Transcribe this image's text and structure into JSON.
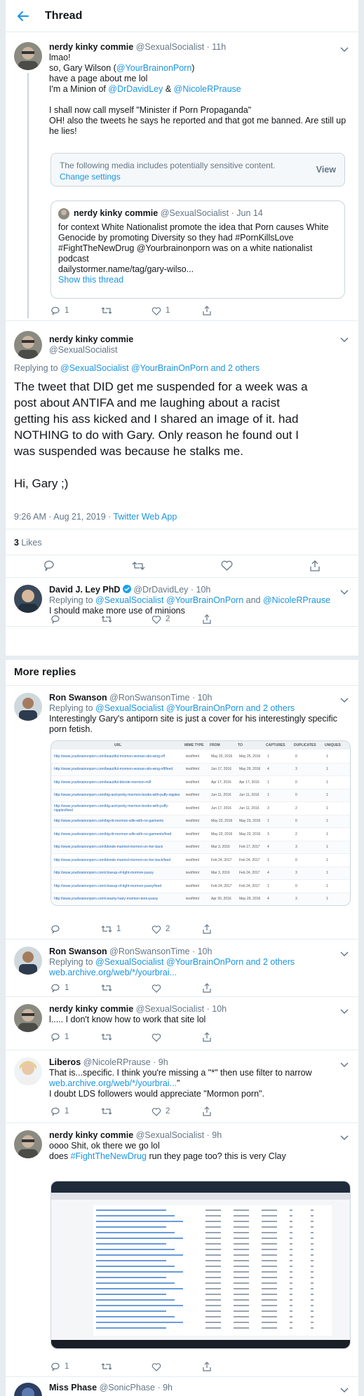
{
  "header": {
    "title": "Thread"
  },
  "tweet1": {
    "name": "nerdy kinky commie",
    "handle": "@SexualSocialist",
    "time": "· 11h",
    "lines": [
      [
        "lmao!"
      ],
      [
        "so, Gary Wilson (",
        "@YourBrainonPorn",
        ")"
      ],
      [
        "have a page about me lol"
      ],
      [
        "I'm a Minion of ",
        "@DrDavidLey",
        " & ",
        "@NicoleRPrause"
      ],
      [
        ""
      ],
      [
        "I shall now call myself \"Minister if Porn Propaganda\""
      ],
      [
        "OH! also the tweets he says he reported and that got me banned. Are still up"
      ],
      [
        "he lies!"
      ]
    ],
    "sensitive_text": "The following media includes potentially sensitive content.",
    "sensitive_settings": "Change settings",
    "sensitive_view": "View",
    "quote": {
      "name": "nerdy kinky commie",
      "handle": "@SexualSocialist · Jun 14",
      "lines": [
        "for context White Nationalist promote the idea that Porn causes White",
        "Genocide by promoting Diversity so they had #PornKillsLove",
        "#FightTheNewDrug @Yourbrainonporn was on a white nationalist",
        "podcast",
        "dailystormer.name/tag/gary-wilso..."
      ],
      "show": "Show this thread"
    },
    "reply_count": "1",
    "retweet_count": "",
    "like_count": "1"
  },
  "main": {
    "name": "nerdy kinky commie",
    "handle": "@SexualSocialist",
    "replying_prefix": "Replying to ",
    "replying_links": "@SexualSocialist @YourBrainOnPorn",
    "replying_suffix": " and 2 others",
    "text_lines": [
      "The tweet that DID get me suspended for a week was a",
      "post about ANTIFA and me laughing about a racist",
      "getting his ass kicked and I shared an image of it. had",
      "NOTHING to do with Gary. Only reason he found out I",
      "was suspended was because he stalks me.",
      "",
      "Hi, Gary ;)"
    ],
    "timestamp": "9:26 AM · Aug 21, 2019 · ",
    "source": "Twitter Web App",
    "likes_count": "3",
    "likes_label": " Likes"
  },
  "ley": {
    "name": "David J. Ley PhD",
    "handle": "@DrDavidLey · 10h",
    "replying_prefix": "Replying to ",
    "replying_links": "@SexualSocialist @YourBrainOnPorn",
    "replying_mid": " and ",
    "replying_last": "@NicoleRPrause",
    "text": "I should make more use of minions",
    "like_count": "2"
  },
  "more_replies": "More replies",
  "swanson1": {
    "name": "Ron Swanson",
    "handle": "@RonSwansonTime · 10h",
    "replying_prefix": "Replying to ",
    "replying_links": "@SexualSocialist @YourBrainOnPorn",
    "replying_suffix": " and 2 others",
    "lines": [
      "Interestingly Gary's antiporn site is just a cover for his interestingly specific",
      "porn fetish."
    ],
    "table_headers": [
      "URL",
      "MIME TYPE",
      "FROM",
      "TO",
      "CAPTURES",
      "DUPLICATES",
      "UNIQUES"
    ],
    "table_rows": [
      [
        "http://www.yourbrainonporn.com/beautiful-mormon-woman-sits-wing-off",
        "text/html",
        "May 25, 2016",
        "May 25, 2016",
        "1",
        "0",
        "1"
      ],
      [
        "http://www.yourbrainonporn.com/beautiful-mormon-woman-sits-wing-off/feed",
        "text/html",
        "Jun 17, 2016",
        "May 29, 2016",
        "4",
        "3",
        "1"
      ],
      [
        "http://www.yourbrainonporn.com/beautiful-blonde-mormon-milf",
        "text/html",
        "Apr 17, 2016",
        "Apr 17, 2016",
        "1",
        "0",
        "1"
      ],
      [
        "http://www.yourbrainonporn.com/big-and-perky-mormon-boobs-with-puffy-nipples",
        "text/html",
        "Jun 11, 2016",
        "Jun 11, 2016",
        "1",
        "0",
        "1"
      ],
      [
        "http://www.yourbrainonporn.com/big-and-perky-mormon-boobs-with-puffy-nipples/feed",
        "text/html",
        "Jun 17, 2016",
        "Jun 11, 2016",
        "3",
        "2",
        "1"
      ],
      [
        "http://www.yourbrainonporn.com/big-tit-mormon-wife-with-no-garments",
        "text/html",
        "May 23, 2016",
        "May 23, 2016",
        "1",
        "0",
        "1"
      ],
      [
        "http://www.yourbrainonporn.com/big-tit-mormon-wife-with-no-garments/feed",
        "text/html",
        "May 23, 2016",
        "May 23, 2016",
        "3",
        "2",
        "1"
      ],
      [
        "http://www.yourbrainonporn.com/blonde-married-mormon-on-her-back",
        "text/html",
        "Mar 3, 2016",
        "Feb 17, 2017",
        "4",
        "3",
        "1"
      ],
      [
        "http://www.yourbrainonporn.com/blonde-married-mormon-on-her-back/feed",
        "text/html",
        "Feb 24, 2017",
        "Feb 24, 2017",
        "1",
        "0",
        "1"
      ],
      [
        "http://www.yourbrainonporn.com/closeup-of-tight-mormon-pussy",
        "text/html",
        "Mar 3, 2016",
        "Feb 24, 2017",
        "4",
        "3",
        "1"
      ],
      [
        "http://www.yourbrainonporn.com/closeup-of-tight-mormon-pussy/feed",
        "text/html",
        "Feb 24, 2017",
        "Feb 24, 2017",
        "1",
        "0",
        "1"
      ],
      [
        "http://www.yourbrainonporn.com/creamy-hairy-mormon-teen-pussy",
        "text/html",
        "Apr 30, 2016",
        "May 29, 2016",
        "4",
        "3",
        "1"
      ]
    ],
    "reply_count": "",
    "retweet_count": "1",
    "like_count": "2"
  },
  "swanson2": {
    "name": "Ron Swanson",
    "handle": "@RonSwansonTime · 10h",
    "replying_prefix": "Replying to ",
    "replying_links": "@SexualSocialist @YourBrainOnPorn",
    "replying_suffix": " and 2 others",
    "link": "web.archive.org/web/*/yourbrai...",
    "reply_count": "1"
  },
  "commie2": {
    "name": "nerdy kinky commie",
    "handle": "@SexualSocialist · 10h",
    "text": "l..... I don't know how to work that site lol",
    "reply_count": "1"
  },
  "liberos": {
    "name": "Liberos",
    "handle": "@NicoleRPrause · 9h",
    "line1": "That is...specific. I think you're missing a \"*\" then use filter to narrow",
    "line2_link": "web.archive.org/web/*/yourbrai...",
    "line2_tail": "\"",
    "line3": "I doubt LDS followers would appreciate \"Mormon porn\".",
    "reply_count": "1",
    "like_count": "2"
  },
  "commie3": {
    "name": "nerdy kinky commie",
    "handle": "@SexualSocialist · 9h",
    "line1": "oooo Shit, ok there we go lol",
    "line2_prefix": "does ",
    "line2_link": "#FightTheNewDrug",
    "line2_tail": " run they page too? this is very Clay",
    "reply_count": "1"
  },
  "phase": {
    "name": "Miss Phase",
    "handle": "@SonicPhase · 9h"
  },
  "colors": {
    "accent": "#1b95e0",
    "muted": "#657786",
    "border": "#e6ecf0"
  }
}
